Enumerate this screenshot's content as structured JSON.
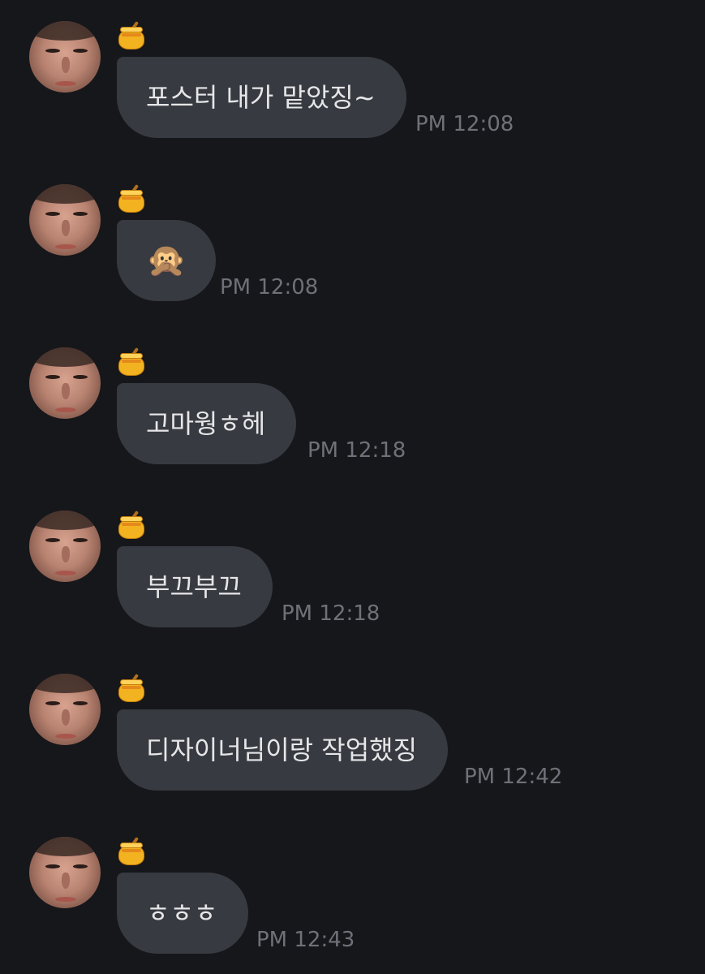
{
  "messages": [
    {
      "text": "포스터 내가 맡았징~",
      "time": "PM 12:08",
      "badge_icon": "honey-pot-icon",
      "emoji": false
    },
    {
      "text": "🙊",
      "time": "PM 12:08",
      "badge_icon": "honey-pot-icon",
      "emoji": true
    },
    {
      "text": "고마웡ㅎ헤",
      "time": "PM 12:18",
      "badge_icon": "honey-pot-icon",
      "emoji": false
    },
    {
      "text": "부끄부끄",
      "time": "PM 12:18",
      "badge_icon": "honey-pot-icon",
      "emoji": false
    },
    {
      "text": "디자이너님이랑 작업했징",
      "time": "PM 12:42",
      "badge_icon": "honey-pot-icon",
      "emoji": false
    },
    {
      "text": "ㅎㅎㅎ",
      "time": "PM 12:43",
      "badge_icon": "honey-pot-icon",
      "emoji": false
    }
  ],
  "colors": {
    "background": "#16171b",
    "bubble": "#373a40",
    "bubble_text": "#e6e6e8",
    "timestamp": "#6f7178"
  }
}
